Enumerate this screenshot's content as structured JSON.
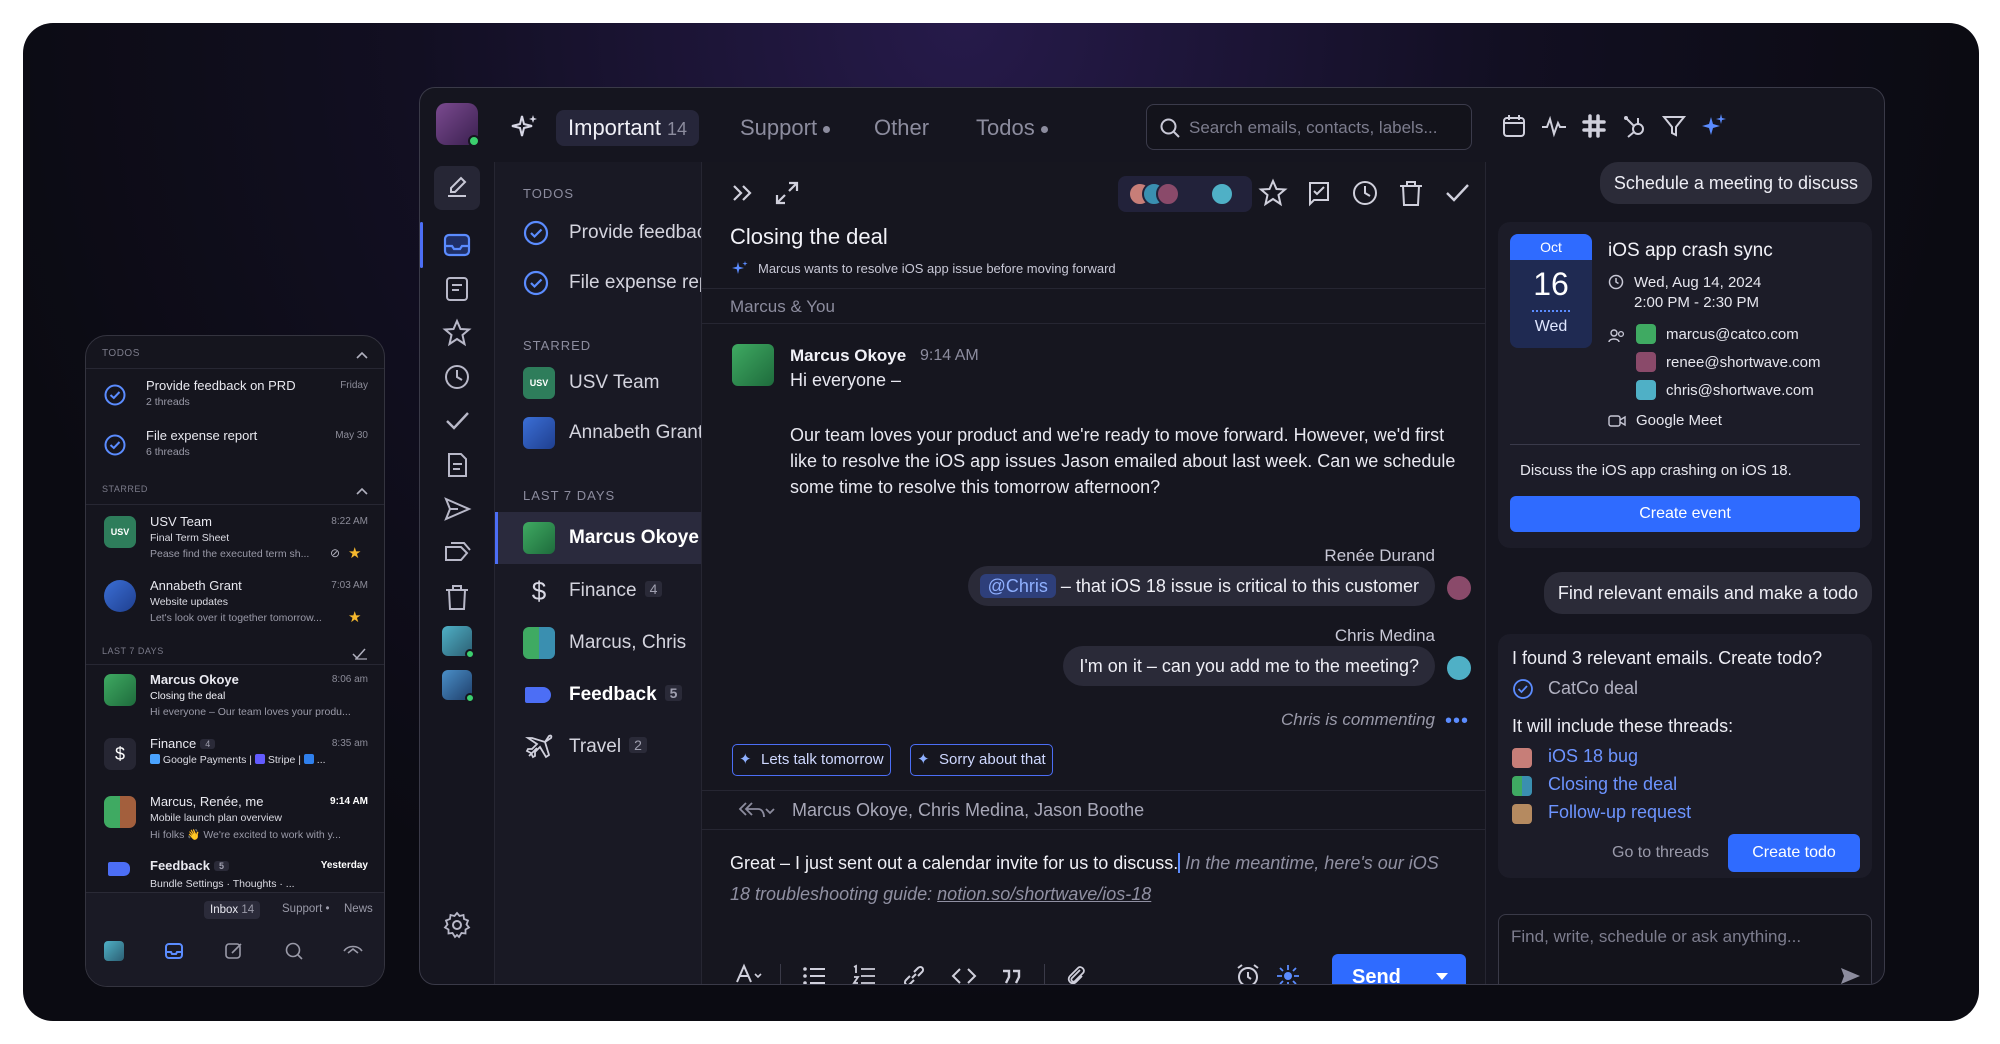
{
  "phone": {
    "todos_header": "TODOS",
    "todos": [
      {
        "title": "Provide feedback on PRD",
        "sub": "2 threads",
        "date": "Friday"
      },
      {
        "title": "File expense report",
        "sub": "6 threads",
        "date": "May 30"
      }
    ],
    "starred_header": "STARRED",
    "starred": [
      {
        "avatar": "USV",
        "title": "USV Team",
        "subject": "Final Term Sheet",
        "preview": "Pease find the executed term sh...",
        "date": "8:22 AM"
      },
      {
        "title": "Annabeth Grant",
        "subject": "Website updates",
        "preview": "Let's look over it together tomorrow...",
        "date": "7:03 AM"
      }
    ],
    "last7_header": "LAST 7 DAYS",
    "recent": [
      {
        "title": "Marcus Okoye",
        "subject": "Closing the deal",
        "preview": "Hi everyone – Our team loves your produ...",
        "date": "8:06 am"
      },
      {
        "title": "Finance",
        "count": "4",
        "subject": "",
        "preview_items": [
          "Google Payments",
          "Stripe"
        ],
        "date": "8:35 am"
      },
      {
        "title": "Marcus, Renée, me",
        "subject": "Mobile launch plan overview",
        "preview": "Hi folks 👋 We're excited to work with y...",
        "date": "9:14 AM"
      },
      {
        "title": "Feedback",
        "count": "5",
        "subject": "Bundle Settings · Thoughts · ...",
        "date": "Yesterday"
      }
    ],
    "tabs": [
      {
        "label": "Inbox",
        "count": "14"
      },
      {
        "label": "Support"
      },
      {
        "label": "News"
      }
    ]
  },
  "top": {
    "tabs": [
      {
        "label": "Important",
        "count": "14"
      },
      {
        "label": "Support"
      },
      {
        "label": "Other"
      },
      {
        "label": "Todos"
      }
    ],
    "search_placeholder": "Search emails, contacts, labels..."
  },
  "list": {
    "todos_header": "TODOS",
    "todos": [
      "Provide feedback on PRD",
      "File expense report"
    ],
    "starred_header": "STARRED",
    "starred": [
      {
        "label": "USV Team",
        "avatar": "USV"
      },
      {
        "label": "Annabeth Grant"
      }
    ],
    "last7_header": "LAST 7 DAYS",
    "recent": [
      {
        "label": "Marcus Okoye"
      },
      {
        "label": "Finance",
        "count": "4"
      },
      {
        "label": "Marcus, Chris"
      },
      {
        "label": "Feedback",
        "count": "5"
      },
      {
        "label": "Travel",
        "count": "2"
      }
    ]
  },
  "thread": {
    "title": "Closing the deal",
    "ai_summary": "Marcus wants to resolve iOS app issue before moving forward",
    "participants": "Marcus & You",
    "message": {
      "sender": "Marcus Okoye",
      "time": "9:14 AM",
      "greeting": "Hi everyone –",
      "body": "Our team loves your product and we're ready to move forward. However, we'd first like to resolve the iOS app issues Jason emailed about last week. Can we schedule some time to resolve this tomorrow afternoon?"
    },
    "comments": [
      {
        "author": "Renée Durand",
        "mention": "@Chris",
        "text": " – that iOS 18 issue is critical to this customer"
      },
      {
        "author": "Chris Medina",
        "text": "I'm on it – can you add me to the meeting?"
      }
    ],
    "typing": "Chris is commenting",
    "suggestions": [
      "Lets talk tomorrow",
      "Sorry about that"
    ],
    "reply_to": "Marcus Okoye, Chris Medina, Jason Boothe",
    "draft_text": "Great – I just sent out a calendar invite for us to discuss.",
    "draft_suggest": " In the meantime, here's our iOS 18 troubleshooting guide: ",
    "draft_link": "notion.so/shortwave/ios-18",
    "send_label": "Send"
  },
  "assistant": {
    "prompt1": "Schedule a meeting to discuss",
    "event": {
      "month": "Oct",
      "day": "16",
      "weekday": "Wed",
      "title": "iOS app crash sync",
      "date": "Wed, Aug 14, 2024",
      "time": "2:00 PM - 2:30 PM",
      "guests": [
        "marcus@catco.com",
        "renee@shortwave.com",
        "chris@shortwave.com"
      ],
      "location": "Google Meet",
      "description": "Discuss the iOS app crashing on iOS 18.",
      "button": "Create event"
    },
    "prompt2": "Find relevant emails and make a todo",
    "todo": {
      "intro": "I found 3 relevant emails. Create todo?",
      "name": "CatCo deal",
      "include": "It will include these threads:",
      "threads": [
        "iOS 18 bug",
        "Closing the deal",
        "Follow-up request"
      ],
      "secondary": "Go to threads",
      "primary": "Create todo"
    },
    "input_placeholder": "Find, write, schedule or ask anything..."
  },
  "colors": {
    "accent": "#2f6bff",
    "link": "#6d94ff",
    "online": "#3ccf6e",
    "star": "#f5b82e"
  }
}
